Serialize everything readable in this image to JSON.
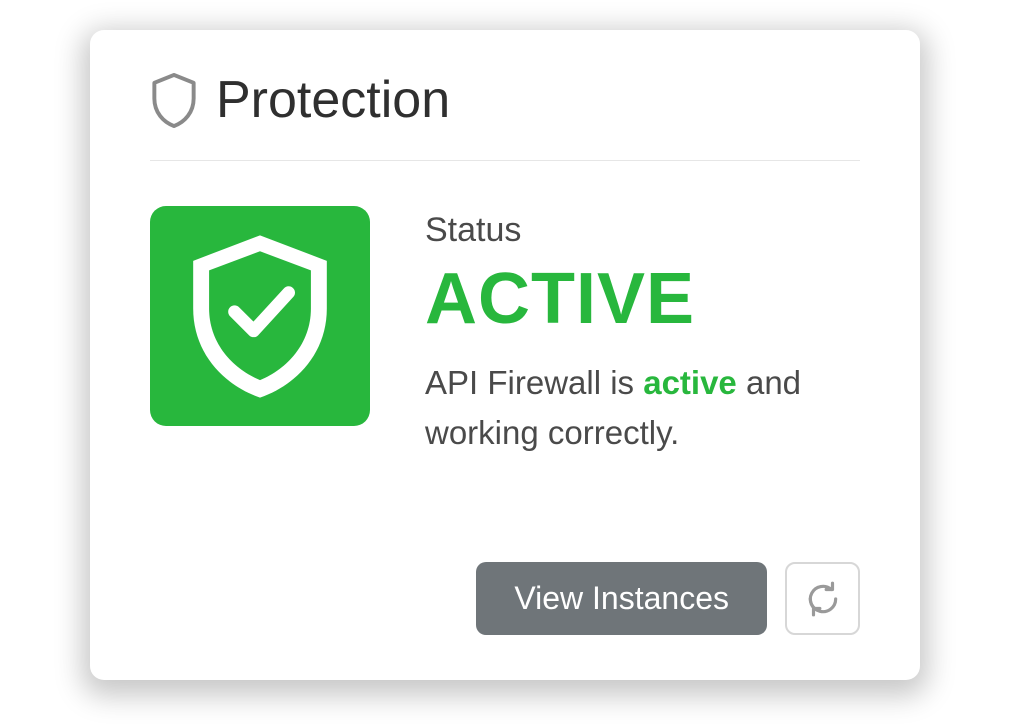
{
  "card": {
    "title": "Protection",
    "status_label": "Status",
    "status_value": "ACTIVE",
    "desc_prefix": "API Firewall is ",
    "desc_highlight": "active",
    "desc_suffix": " and working correctly.",
    "view_button": "View Instances",
    "colors": {
      "accent": "#28b73d",
      "button_bg": "#6f7579"
    }
  }
}
